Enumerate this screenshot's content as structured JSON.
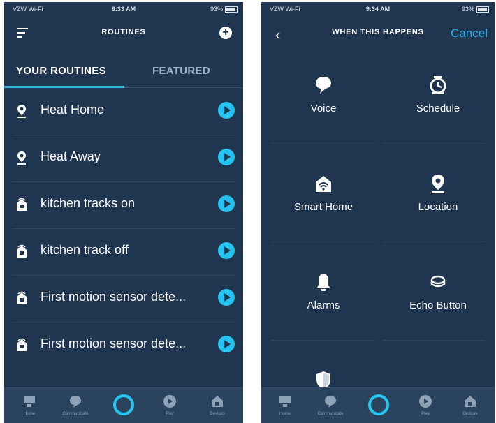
{
  "left": {
    "status": {
      "carrier": "VZW Wi-Fi",
      "time": "9:33 AM",
      "battery": "93%"
    },
    "title": "ROUTINES",
    "tabs": [
      {
        "label": "YOUR ROUTINES"
      },
      {
        "label": "FEATURED"
      }
    ],
    "routines": [
      {
        "label": "Heat Home",
        "icon": "location-pin-icon"
      },
      {
        "label": "Heat Away",
        "icon": "location-pin-icon"
      },
      {
        "label": "kitchen tracks on",
        "icon": "smart-home-icon"
      },
      {
        "label": "kitchen track off",
        "icon": "smart-home-icon"
      },
      {
        "label": "First motion sensor dete...",
        "icon": "smart-home-icon"
      },
      {
        "label": "First motion sensor dete...",
        "icon": "smart-home-icon"
      }
    ],
    "bottom_nav": [
      {
        "label": "Home",
        "icon": "home-icon"
      },
      {
        "label": "Communicate",
        "icon": "chat-icon"
      },
      {
        "label": "",
        "icon": "alexa-icon"
      },
      {
        "label": "Play",
        "icon": "play-icon"
      },
      {
        "label": "Devices",
        "icon": "devices-icon"
      }
    ]
  },
  "right": {
    "status": {
      "carrier": "VZW Wi-Fi",
      "time": "9:34 AM",
      "battery": "93%"
    },
    "title": "WHEN THIS HAPPENS",
    "cancel_label": "Cancel",
    "triggers": [
      {
        "label": "Voice",
        "icon": "speech-bubble-icon"
      },
      {
        "label": "Schedule",
        "icon": "alarm-clock-icon"
      },
      {
        "label": "Smart Home",
        "icon": "smart-home-icon"
      },
      {
        "label": "Location",
        "icon": "location-pin-icon"
      },
      {
        "label": "Alarms",
        "icon": "bell-icon"
      },
      {
        "label": "Echo Button",
        "icon": "echo-button-icon"
      },
      {
        "label": "",
        "icon": "shield-icon"
      }
    ],
    "bottom_nav": [
      {
        "label": "Home",
        "icon": "home-icon"
      },
      {
        "label": "Communicate",
        "icon": "chat-icon"
      },
      {
        "label": "",
        "icon": "alexa-icon"
      },
      {
        "label": "Play",
        "icon": "play-icon"
      },
      {
        "label": "Devices",
        "icon": "devices-icon"
      }
    ]
  },
  "colors": {
    "background": "#1f3550",
    "accent": "#27c4f2",
    "link": "#34b2e4"
  }
}
